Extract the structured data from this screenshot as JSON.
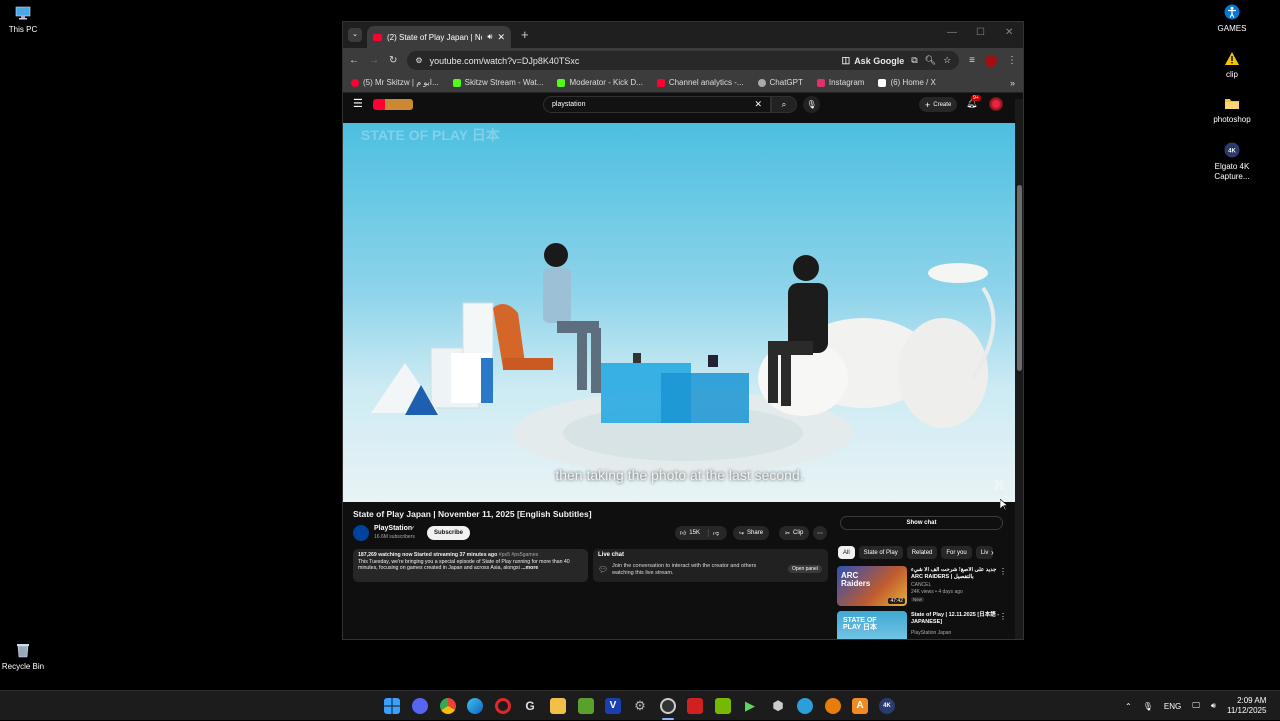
{
  "desktop": {
    "left_icons": [
      {
        "label": "This PC"
      },
      {
        "label": "Recycle Bin"
      }
    ],
    "right_icons": [
      {
        "label": "GAMES"
      },
      {
        "label": "clip"
      },
      {
        "label": "photoshop"
      },
      {
        "label": "Elgato 4K Capture..."
      }
    ]
  },
  "browser": {
    "tab_title": "(2) State of Play Japan | No",
    "url": "youtube.com/watch?v=DJp8K40TSxc",
    "ask_google": "Ask Google",
    "bookmarks": [
      {
        "label": "(5) Mr Skitzw | ابو م...",
        "color": "#ff0033"
      },
      {
        "label": "Skitzw Stream - Wat...",
        "color": "#53fc18"
      },
      {
        "label": "Moderator - Kick D...",
        "color": "#53fc18"
      },
      {
        "label": "Channel analytics -...",
        "color": "#ff0033"
      },
      {
        "label": "ChatGPT",
        "color": "#aaaaaa"
      },
      {
        "label": "Instagram",
        "color": "#e1306c"
      },
      {
        "label": "(6) Home / X",
        "color": "#ffffff"
      }
    ]
  },
  "youtube": {
    "search_value": "playstation",
    "create_label": "Create",
    "notif_count": "9+",
    "caption": "then taking the photo at the last second.",
    "watermark": "STATE OF PLAY 日本",
    "video_title": "State of Play Japan | November 11, 2025 [English Subtitles]",
    "channel": "PlayStation",
    "subscribers": "16.6M subscribers",
    "subscribe_label": "Subscribe",
    "likes": "15K",
    "share_label": "Share",
    "clip_label": "Clip",
    "description": {
      "stats": "187,269 watching now  Started streaming 37 minutes ago",
      "tags": "#ps5 #ps5games",
      "text": "This Tuesday, we're bringing you a special episode of State of Play running for more than 40 minutes, focusing on games created in Japan and across Asia, alongsi",
      "more": "...more"
    },
    "live_chat": {
      "title": "Live chat",
      "text": "Join the conversation to interact with the creator and others watching this live stream.",
      "button": "Open panel"
    },
    "show_chat": "Show chat",
    "chips": [
      "All",
      "State of Play",
      "Related",
      "For you",
      "Liv"
    ],
    "recommendations": [
      {
        "title": "جديد على الأصغ! شرحت الف الا شيء ARC RAIDERS | بالتفصيل",
        "channel": "CANCEL",
        "meta": "24K views • 4 days ago",
        "badge": "New",
        "duration": "47:42",
        "thumb_text": "ARC Raiders",
        "thumb_color": "#4a6cc8"
      },
      {
        "title": "State of Play | 12.11.2025 [日本語 - JAPANESE]",
        "channel": "PlayStation Japan",
        "meta": "",
        "badge": "",
        "duration": "",
        "thumb_text": "STATE OF PLAY 日本",
        "thumb_color": "#3fa8d4"
      }
    ]
  },
  "taskbar": {
    "lang": "ENG",
    "time": "2:09 AM",
    "date": "11/12/2025"
  }
}
